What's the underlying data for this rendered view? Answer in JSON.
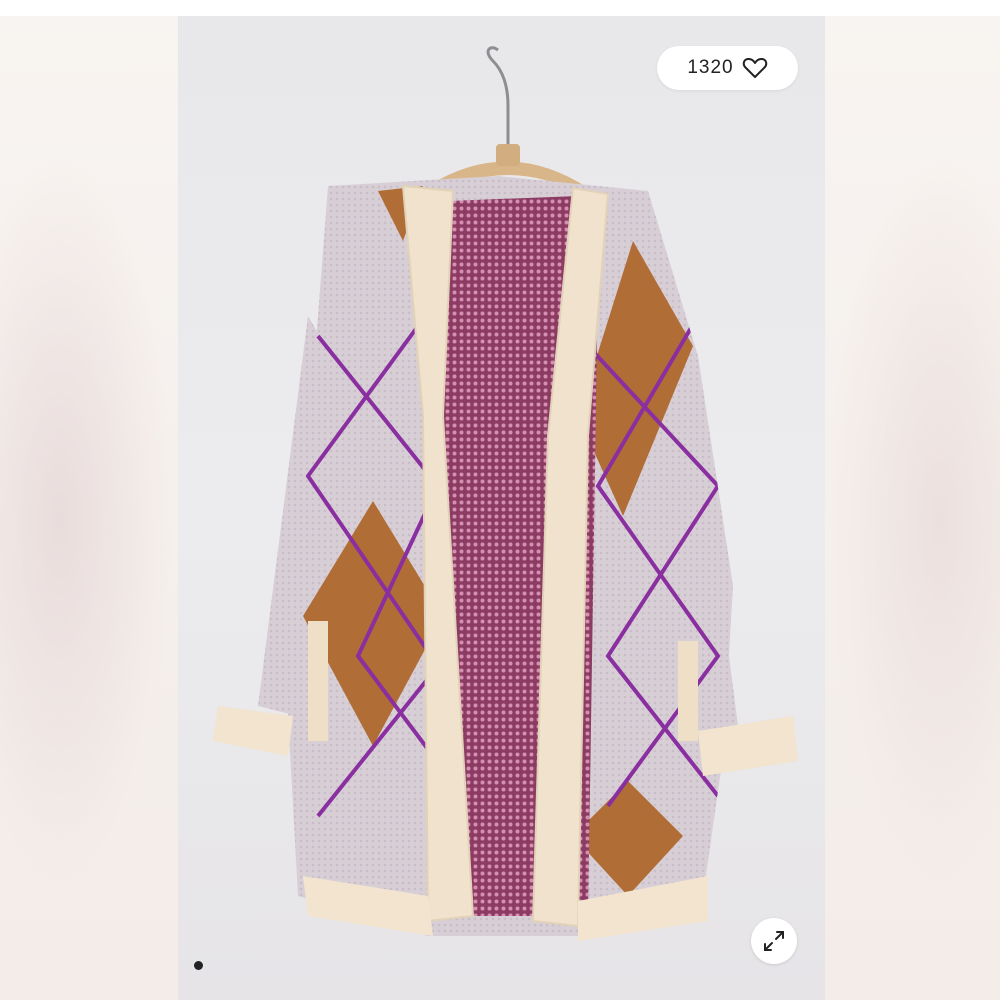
{
  "listing": {
    "like_count": "1320",
    "like_icon": "heart-outline-icon",
    "expand_icon": "expand-arrows-icon",
    "carousel": {
      "total": 1,
      "active": 1
    }
  },
  "colors": {
    "cardigan_base": "#d9d1d6",
    "trim": "#f0e2cc",
    "argyle_brown": "#b06d36",
    "argyle_purple": "#8a2fa0",
    "lining": "#b0607f"
  }
}
